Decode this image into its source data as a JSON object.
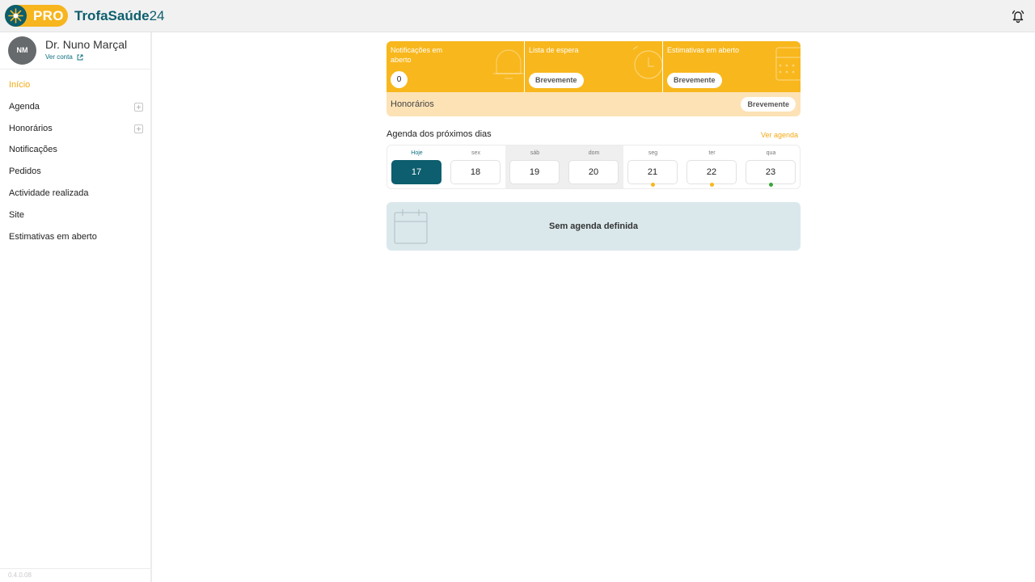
{
  "header": {
    "pro_label": "PRO",
    "brand_name": "TrofaSaúde",
    "brand_number": "24"
  },
  "profile": {
    "initials": "NM",
    "name": "Dr. Nuno Marçal",
    "account_link": "Ver conta"
  },
  "sidebar": {
    "items": [
      {
        "label": "Início",
        "active": true
      },
      {
        "label": "Agenda",
        "has_add": true
      },
      {
        "label": "Honorários",
        "has_add": true
      },
      {
        "label": "Notificações"
      },
      {
        "label": "Pedidos"
      },
      {
        "label": "Actividade realizada"
      },
      {
        "label": "Site"
      },
      {
        "label": "Estimativas em aberto"
      }
    ],
    "version": "0.4.0.08"
  },
  "cards": [
    {
      "title": "Notificações em aberto",
      "value": "0",
      "icon": "bell-icon"
    },
    {
      "title": "Lista de espera",
      "button": "Brevemente",
      "icon": "clock-icon"
    },
    {
      "title": "Estimativas em aberto",
      "button": "Brevemente",
      "icon": "calculator-icon"
    }
  ],
  "fees": {
    "label": "Honorários",
    "button": "Brevemente"
  },
  "agenda": {
    "title": "Agenda dos próximos dias",
    "link": "Ver agenda",
    "days": [
      {
        "label": "Hoje",
        "num": "17",
        "today": true
      },
      {
        "label": "sex",
        "num": "18"
      },
      {
        "label": "sáb",
        "num": "19",
        "weekend": true
      },
      {
        "label": "dom",
        "num": "20",
        "weekend": true
      },
      {
        "label": "seg",
        "num": "21",
        "dot": "#f8b71c"
      },
      {
        "label": "ter",
        "num": "22",
        "dot": "#f8b71c"
      },
      {
        "label": "qua",
        "num": "23",
        "dot": "#3aa63a"
      }
    ],
    "empty_message": "Sem agenda definida"
  },
  "colors": {
    "accent": "#f8b71c",
    "brand": "#0d5e6e"
  }
}
